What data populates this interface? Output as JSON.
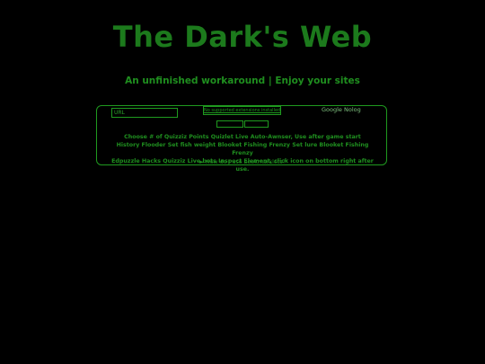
{
  "header": {
    "title": "The Dark's Web",
    "subtitle": "An unfinished workaround | Enjoy your sites"
  },
  "toolbar": {
    "url_placeholder": "URL",
    "extension_select": "No supported extensions installed",
    "search_engine": "Google Nolog"
  },
  "bookmarklets": {
    "line1": [
      "Choose # of Quizziz Points",
      "Quizlet Live Auto-Awnser, Use after game start"
    ],
    "line2": [
      "History Flooder",
      "Set fish weight",
      "Blooket Fishing Frenzy",
      "Set lure",
      "Blooket Fishing Frenzy"
    ],
    "line3": [
      "Edpuzzle Hacks",
      "Quizziz Live bots",
      "Inspect Element, click icon on bottom right after use."
    ]
  },
  "help": {
    "arrow": "►",
    "label": "How do I use bookmarklets?"
  },
  "colors": {
    "background": "#000000",
    "accent": "#1f9a1f",
    "title": "#1c7a1c"
  }
}
